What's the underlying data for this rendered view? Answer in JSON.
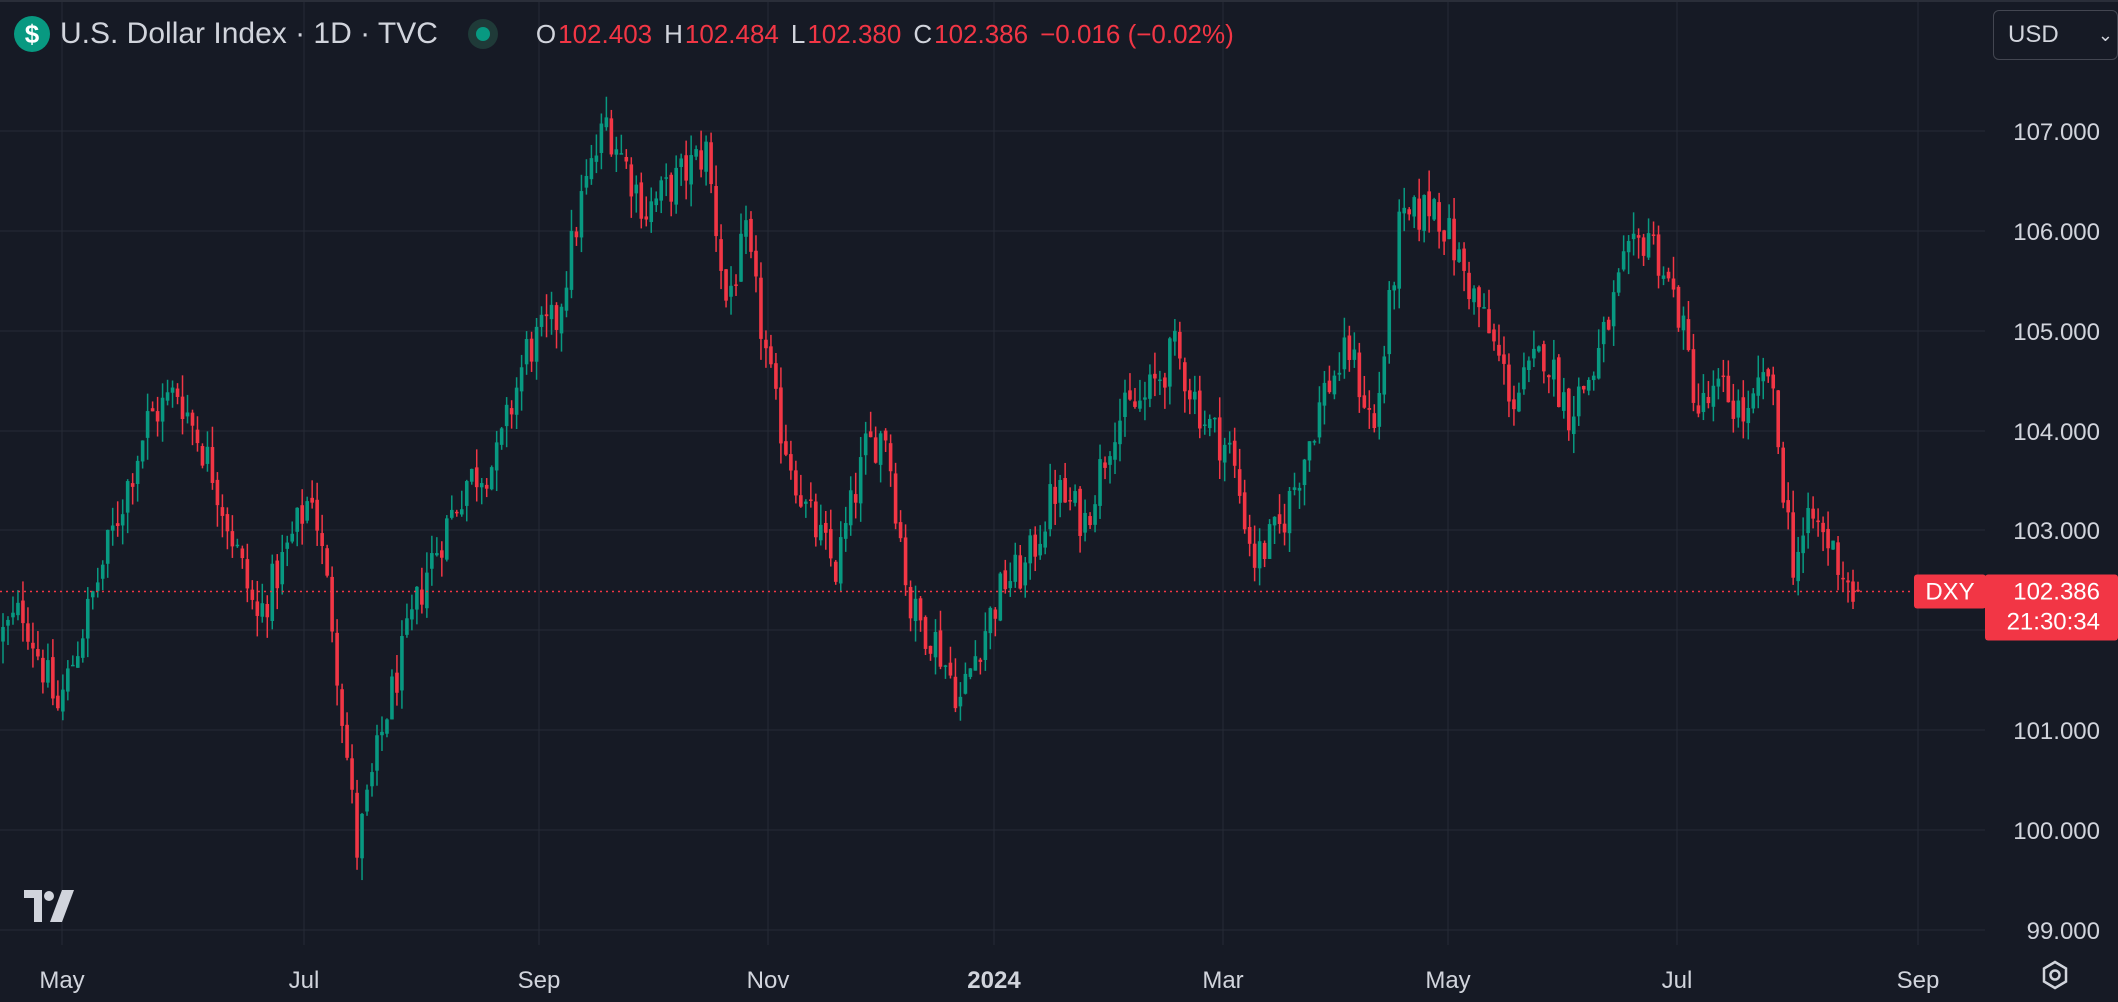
{
  "header": {
    "symbol_badge": "$",
    "title": "U.S. Dollar Index · 1D · TVC",
    "ohlc": {
      "o_label": "O",
      "o_value": "102.403",
      "h_label": "H",
      "h_value": "102.484",
      "l_label": "L",
      "l_value": "102.380",
      "c_label": "C",
      "c_value": "102.386",
      "change": "−0.016 (−0.02%)"
    }
  },
  "currency_select": {
    "value": "USD"
  },
  "price_tag": {
    "symbol": "DXY",
    "price": "102.386",
    "countdown": "21:30:34"
  },
  "colors": {
    "up": "#089981",
    "down": "#f23645",
    "background": "#161a25",
    "grid": "#262b37",
    "text": "#d1d4dc",
    "accent": "#089981"
  },
  "icons": {
    "logo": "tradingview-logo",
    "settings": "gear-icon",
    "status": "live-dot-icon"
  },
  "chart_data": {
    "type": "candlestick",
    "ylim": [
      98.8,
      107.8
    ],
    "y_ticks": [
      "107.000",
      "106.000",
      "105.000",
      "104.000",
      "103.000",
      "101.000",
      "100.000",
      "99.000"
    ],
    "x_ticks": [
      "May",
      "Jul",
      "Sep",
      "Nov",
      "2024",
      "Mar",
      "May",
      "Jul",
      "Sep"
    ],
    "last_price": 102.386,
    "anchors": [
      [
        0,
        101.9
      ],
      [
        5,
        102.2
      ],
      [
        12,
        101.2
      ],
      [
        20,
        102.5
      ],
      [
        30,
        104.1
      ],
      [
        36,
        104.4
      ],
      [
        43,
        103.6
      ],
      [
        52,
        102.1
      ],
      [
        58,
        102.8
      ],
      [
        63,
        103.4
      ],
      [
        67,
        102.1
      ],
      [
        72,
        99.8
      ],
      [
        78,
        101.2
      ],
      [
        86,
        102.6
      ],
      [
        94,
        103.5
      ],
      [
        100,
        103.7
      ],
      [
        106,
        104.8
      ],
      [
        112,
        105.1
      ],
      [
        117,
        106.3
      ],
      [
        122,
        107.1
      ],
      [
        130,
        106.2
      ],
      [
        138,
        106.6
      ],
      [
        142,
        106.8
      ],
      [
        146,
        105.3
      ],
      [
        150,
        105.9
      ],
      [
        156,
        104.2
      ],
      [
        162,
        103.2
      ],
      [
        168,
        102.6
      ],
      [
        174,
        103.8
      ],
      [
        178,
        104.0
      ],
      [
        183,
        102.2
      ],
      [
        188,
        101.9
      ],
      [
        193,
        101.3
      ],
      [
        197,
        101.9
      ],
      [
        202,
        102.5
      ],
      [
        206,
        102.6
      ],
      [
        212,
        103.4
      ],
      [
        218,
        103.1
      ],
      [
        224,
        104.1
      ],
      [
        230,
        104.3
      ],
      [
        236,
        104.8
      ],
      [
        242,
        104.1
      ],
      [
        247,
        103.8
      ],
      [
        252,
        102.7
      ],
      [
        257,
        103.0
      ],
      [
        261,
        103.6
      ],
      [
        266,
        104.4
      ],
      [
        271,
        104.8
      ],
      [
        276,
        104.0
      ],
      [
        281,
        106.0
      ],
      [
        288,
        106.3
      ],
      [
        293,
        105.7
      ],
      [
        298,
        105.1
      ],
      [
        304,
        104.3
      ],
      [
        310,
        104.8
      ],
      [
        315,
        104.2
      ],
      [
        320,
        104.6
      ],
      [
        326,
        105.6
      ],
      [
        331,
        106.0
      ],
      [
        337,
        105.2
      ],
      [
        341,
        104.2
      ],
      [
        346,
        104.4
      ],
      [
        351,
        104.1
      ],
      [
        355,
        104.6
      ],
      [
        360,
        102.7
      ],
      [
        364,
        103.1
      ],
      [
        368,
        102.8
      ],
      [
        372,
        102.386
      ]
    ],
    "bar_count": 373,
    "current_bar_ohlc": {
      "open": 102.403,
      "high": 102.484,
      "low": 102.38,
      "close": 102.386
    }
  }
}
